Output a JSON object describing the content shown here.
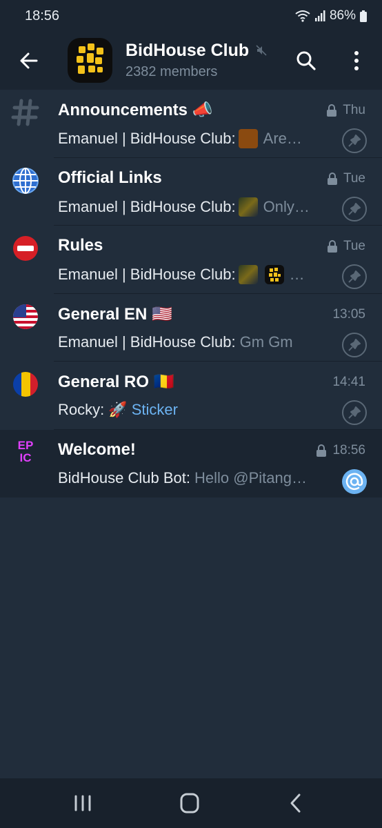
{
  "status_bar": {
    "time": "18:56",
    "battery": "86%"
  },
  "header": {
    "title": "BidHouse Club",
    "subtitle": "2382 members"
  },
  "topics": [
    {
      "name": "Announcements 📣",
      "date": "Thu",
      "locked": true,
      "sender": "Emanuel | BidHouse Club:",
      "text": "Are…",
      "icon": "hashtag-icon",
      "pinned": true
    },
    {
      "name": "Official Links",
      "date": "Tue",
      "locked": true,
      "sender": "Emanuel | BidHouse Club:",
      "text": "Only…",
      "icon": "globe-icon",
      "pinned": true
    },
    {
      "name": "Rules",
      "date": "Tue",
      "locked": true,
      "sender": "Emanuel | BidHouse Club:",
      "text": "…",
      "icon": "no-entry-icon",
      "pinned": true
    },
    {
      "name": "General EN 🇺🇸",
      "date": "13:05",
      "locked": false,
      "sender": "Emanuel | BidHouse Club:",
      "text": "Gm Gm",
      "icon": "us-flag-icon",
      "pinned": true
    },
    {
      "name": "General RO 🇷🇴",
      "date": "14:41",
      "locked": false,
      "sender": "Rocky: 🚀",
      "text": "Sticker",
      "icon": "ro-flag-icon",
      "pinned": true
    },
    {
      "name": "Welcome!",
      "date": "18:56",
      "locked": true,
      "sender": "BidHouse Club Bot:",
      "text": "Hello @Pitang…",
      "icon": "epic-icon",
      "pinned": false,
      "mention": true
    }
  ],
  "colors": {
    "background": "#212d3b",
    "header": "#1b2531",
    "accent": "#6cb3f2",
    "muted": "#7e8d9c"
  }
}
